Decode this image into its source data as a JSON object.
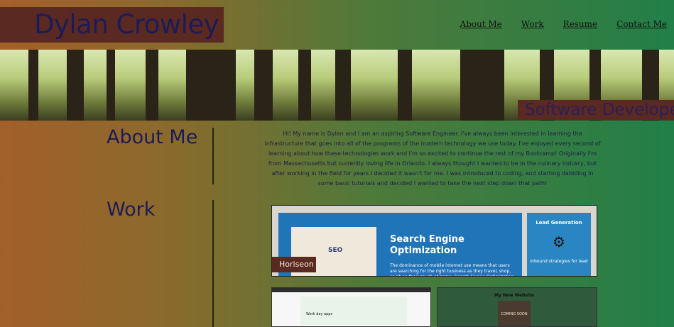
{
  "header": {
    "brand_name": "Dylan Crowley",
    "nav": [
      {
        "label": "About Me"
      },
      {
        "label": "Work"
      },
      {
        "label": "Resume"
      },
      {
        "label": "Contact Me"
      }
    ]
  },
  "hero": {
    "tagline": "Software Developer",
    "image_icon": "forest-image"
  },
  "about": {
    "title": "About Me",
    "text": "Hi! My name is Dylan and I am an aspiring Software Engineer. I've always been interested in learning the infrastructure that goes into all of the programs of the modern technology we use today. I've enjoyed every second of learning about how these technologies work and I'm so excited to continue the rest of my Bootcamp! Originally I'm from Massachusetts but currently loving life in Orlando. I always thought I wanted to be in the culinary indusry, but after working in the field for years I decided it wasn't for me. I was introduced to coding, and starting dabbling in some basic tutorials and decided I wanted to take the next step down that path!"
  },
  "work": {
    "title": "Work",
    "featured": {
      "project_name": "Horiseon",
      "heading": "Search Engine Optimization",
      "body": "The dominance of mobile internet use means that users are searching for the right business as they travel, shop, or sit on their couch at home. Search Engine Optimization (SEO) allows you to increase your visibility and find the right customers for your",
      "side_heading": "Lead Generation",
      "side_text": "Inbound strategies for lead",
      "seo_image_label": "SEO"
    },
    "thumbnails": [
      {
        "caption": "Work day apps"
      },
      {
        "caption": "My New Website",
        "box_label": "COMING SOON"
      }
    ]
  },
  "colors": {
    "brand_bg": "#5a2a22",
    "brand_text": "#1d1b57",
    "page_gradient_start": "#a35f2a",
    "page_gradient_end": "#227f48",
    "seo_blue": "#2074b8"
  }
}
